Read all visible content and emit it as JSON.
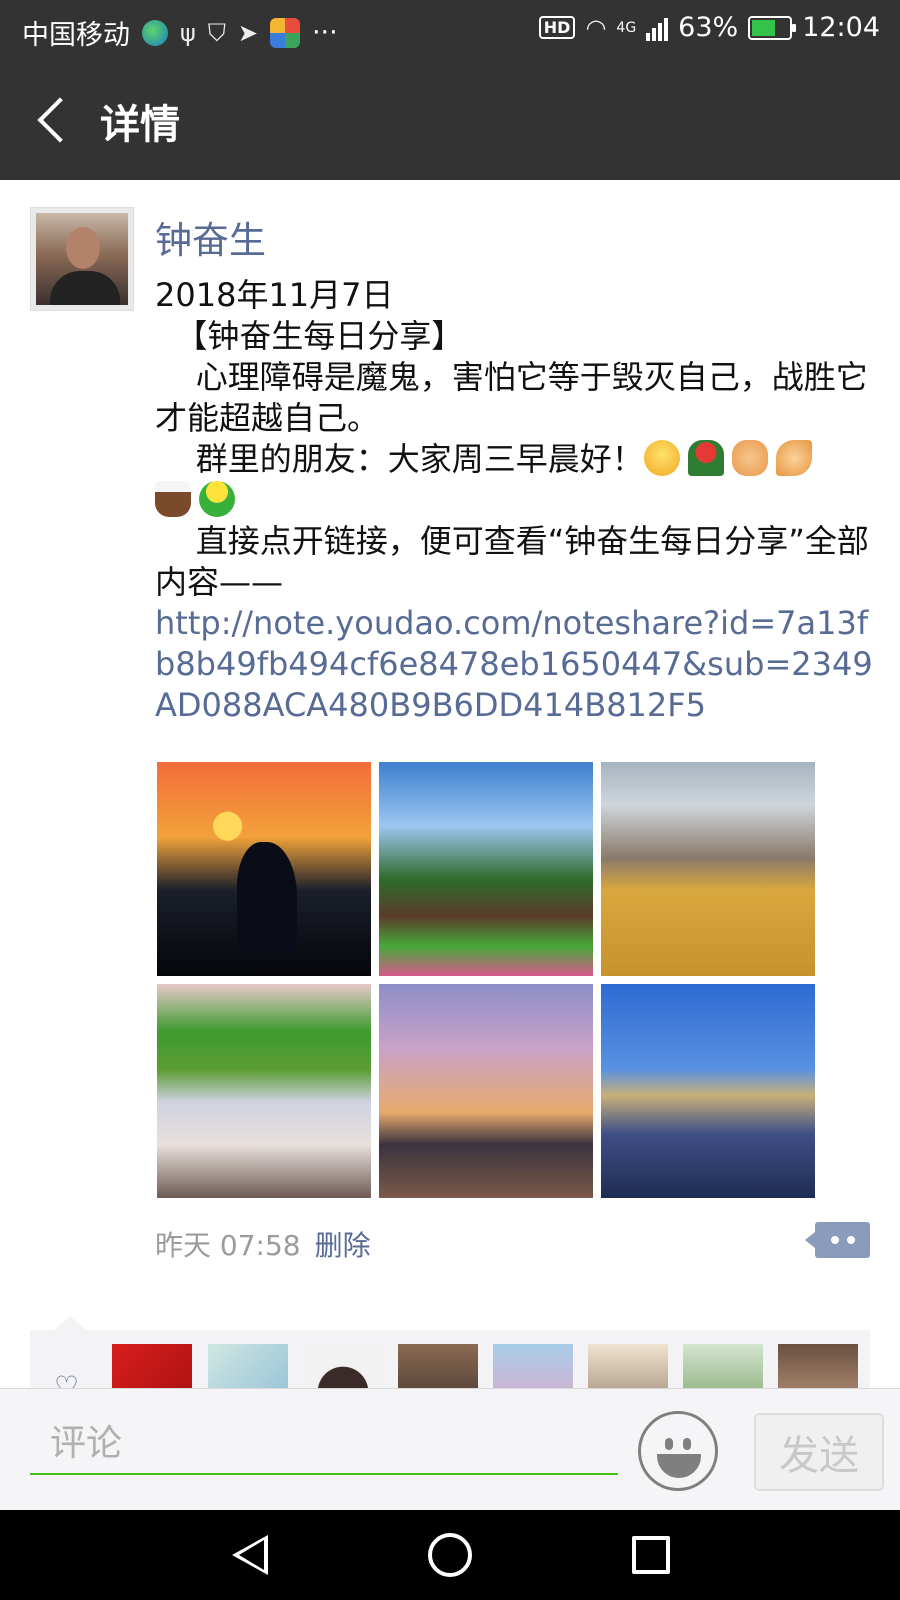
{
  "status_bar": {
    "carrier": "中国移动",
    "network": "4G",
    "battery": "63%",
    "battery_level": 0.63,
    "time": "12:04",
    "hd_label": "HD",
    "more": "···"
  },
  "header": {
    "title": "详情"
  },
  "post": {
    "author": "钟奋生",
    "lines": [
      "2018年11月7日",
      "  【钟奋生每日分享】",
      "    心理障碍是魔鬼，害怕它等于毁灭自己，战胜它才能超越自己。",
      "    群里的朋友：大家周三早晨好！",
      "    直接点开链接，便可查看“钟奋生每日分享”全部内容——"
    ],
    "link": "http://note.youdao.com/noteshare?id=7a13fb8b49fb494cf6e8478eb1650447&sub=2349AD088ACA480B9B6DD414B812F5",
    "emoji_icons": [
      "smile-emoji",
      "rose-emoji",
      "handshake-emoji",
      "pray-emoji",
      "coffee-emoji",
      "green-man-emoji"
    ],
    "photos": [
      "crane-sunset-photo",
      "cottage-photo",
      "abbey-hill-photo",
      "colorful-town-photo",
      "gothic-church-photo",
      "castle-night-photo"
    ],
    "time": "昨天 07:58",
    "delete_label": "删除"
  },
  "comment_bar": {
    "placeholder": "评论",
    "send_label": "发送"
  },
  "colors": {
    "link": "#576b95",
    "header_bg": "#333333",
    "input_underline": "#45c01a"
  }
}
